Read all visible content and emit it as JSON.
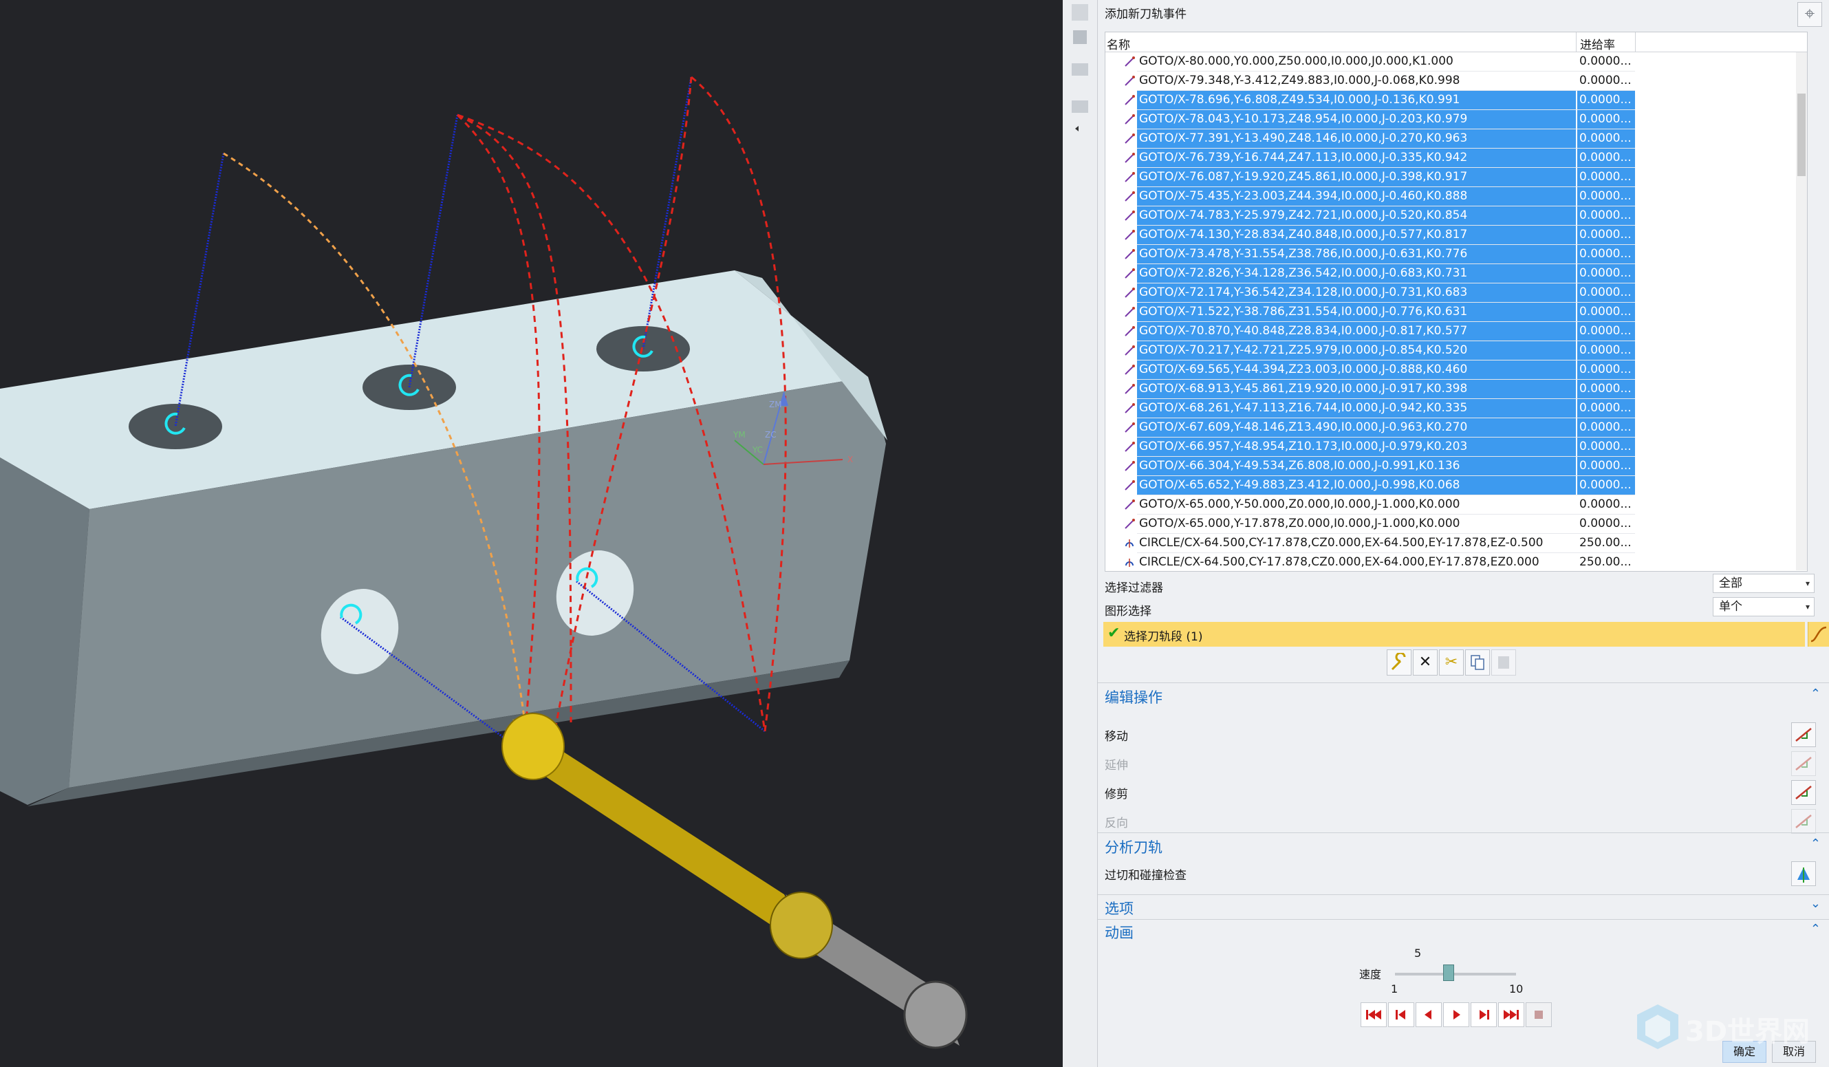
{
  "panel": {
    "title": "添加新刀轨事件",
    "list": {
      "col_name": "名称",
      "col_feed": "进给率",
      "rows": [
        {
          "name": "GOTO/X-80.000,Y0.000,Z50.000,I0.000,J0.000,K1.000",
          "feed": "0.0000...",
          "selected": false,
          "kind": "goto"
        },
        {
          "name": "GOTO/X-79.348,Y-3.412,Z49.883,I0.000,J-0.068,K0.998",
          "feed": "0.0000...",
          "selected": false,
          "kind": "goto"
        },
        {
          "name": "GOTO/X-78.696,Y-6.808,Z49.534,I0.000,J-0.136,K0.991",
          "feed": "0.0000...",
          "selected": true,
          "kind": "goto"
        },
        {
          "name": "GOTO/X-78.043,Y-10.173,Z48.954,I0.000,J-0.203,K0.979",
          "feed": "0.0000...",
          "selected": true,
          "kind": "goto"
        },
        {
          "name": "GOTO/X-77.391,Y-13.490,Z48.146,I0.000,J-0.270,K0.963",
          "feed": "0.0000...",
          "selected": true,
          "kind": "goto"
        },
        {
          "name": "GOTO/X-76.739,Y-16.744,Z47.113,I0.000,J-0.335,K0.942",
          "feed": "0.0000...",
          "selected": true,
          "kind": "goto"
        },
        {
          "name": "GOTO/X-76.087,Y-19.920,Z45.861,I0.000,J-0.398,K0.917",
          "feed": "0.0000...",
          "selected": true,
          "kind": "goto"
        },
        {
          "name": "GOTO/X-75.435,Y-23.003,Z44.394,I0.000,J-0.460,K0.888",
          "feed": "0.0000...",
          "selected": true,
          "kind": "goto"
        },
        {
          "name": "GOTO/X-74.783,Y-25.979,Z42.721,I0.000,J-0.520,K0.854",
          "feed": "0.0000...",
          "selected": true,
          "kind": "goto"
        },
        {
          "name": "GOTO/X-74.130,Y-28.834,Z40.848,I0.000,J-0.577,K0.817",
          "feed": "0.0000...",
          "selected": true,
          "kind": "goto"
        },
        {
          "name": "GOTO/X-73.478,Y-31.554,Z38.786,I0.000,J-0.631,K0.776",
          "feed": "0.0000...",
          "selected": true,
          "kind": "goto"
        },
        {
          "name": "GOTO/X-72.826,Y-34.128,Z36.542,I0.000,J-0.683,K0.731",
          "feed": "0.0000...",
          "selected": true,
          "kind": "goto"
        },
        {
          "name": "GOTO/X-72.174,Y-36.542,Z34.128,I0.000,J-0.731,K0.683",
          "feed": "0.0000...",
          "selected": true,
          "kind": "goto"
        },
        {
          "name": "GOTO/X-71.522,Y-38.786,Z31.554,I0.000,J-0.776,K0.631",
          "feed": "0.0000...",
          "selected": true,
          "kind": "goto"
        },
        {
          "name": "GOTO/X-70.870,Y-40.848,Z28.834,I0.000,J-0.817,K0.577",
          "feed": "0.0000...",
          "selected": true,
          "kind": "goto"
        },
        {
          "name": "GOTO/X-70.217,Y-42.721,Z25.979,I0.000,J-0.854,K0.520",
          "feed": "0.0000...",
          "selected": true,
          "kind": "goto"
        },
        {
          "name": "GOTO/X-69.565,Y-44.394,Z23.003,I0.000,J-0.888,K0.460",
          "feed": "0.0000...",
          "selected": true,
          "kind": "goto"
        },
        {
          "name": "GOTO/X-68.913,Y-45.861,Z19.920,I0.000,J-0.917,K0.398",
          "feed": "0.0000...",
          "selected": true,
          "kind": "goto"
        },
        {
          "name": "GOTO/X-68.261,Y-47.113,Z16.744,I0.000,J-0.942,K0.335",
          "feed": "0.0000...",
          "selected": true,
          "kind": "goto"
        },
        {
          "name": "GOTO/X-67.609,Y-48.146,Z13.490,I0.000,J-0.963,K0.270",
          "feed": "0.0000...",
          "selected": true,
          "kind": "goto"
        },
        {
          "name": "GOTO/X-66.957,Y-48.954,Z10.173,I0.000,J-0.979,K0.203",
          "feed": "0.0000...",
          "selected": true,
          "kind": "goto"
        },
        {
          "name": "GOTO/X-66.304,Y-49.534,Z6.808,I0.000,J-0.991,K0.136",
          "feed": "0.0000...",
          "selected": true,
          "kind": "goto"
        },
        {
          "name": "GOTO/X-65.652,Y-49.883,Z3.412,I0.000,J-0.998,K0.068",
          "feed": "0.0000...",
          "selected": true,
          "kind": "goto"
        },
        {
          "name": "GOTO/X-65.000,Y-50.000,Z0.000,I0.000,J-1.000,K0.000",
          "feed": "0.0000...",
          "selected": false,
          "kind": "goto"
        },
        {
          "name": "GOTO/X-65.000,Y-17.878,Z0.000,I0.000,J-1.000,K0.000",
          "feed": "0.0000...",
          "selected": false,
          "kind": "goto"
        },
        {
          "name": "CIRCLE/CX-64.500,CY-17.878,CZ0.000,EX-64.500,EY-17.878,EZ-0.500",
          "feed": "250.00...",
          "selected": false,
          "kind": "circle"
        },
        {
          "name": "CIRCLE/CX-64.500,CY-17.878,CZ0.000,EX-64.000,EY-17.878,EZ0.000",
          "feed": "250.00...",
          "selected": false,
          "kind": "circle"
        }
      ]
    },
    "filter_label": "选择过滤器",
    "filter_value": "全部",
    "graphic_label": "图形选择",
    "graphic_value": "单个",
    "select_segment": "选择刀轨段 (1)",
    "edit_section": "编辑操作",
    "ops": [
      {
        "label": "移动",
        "enabled": true
      },
      {
        "label": "延伸",
        "enabled": false
      },
      {
        "label": "修剪",
        "enabled": true
      },
      {
        "label": "反向",
        "enabled": false
      }
    ],
    "analyze_section": "分析刀轨",
    "gouge_check": "过切和碰撞检查",
    "options_section": "选项",
    "animation_section": "动画",
    "speed_label": "速度",
    "speed_value": "5",
    "speed_min": "1",
    "speed_max": "10",
    "speed_fraction": 0.444,
    "ok_button": "确定",
    "cancel_button": "取消"
  },
  "viewport": {
    "axis_labels": {
      "zm": "ZM",
      "zc": "ZC",
      "ym": "YM",
      "yc": "YC",
      "x": "X"
    }
  },
  "watermark": "3D世界网",
  "colors": {
    "selection": "#3d9aef",
    "accent": "#1b6ec2",
    "highlight": "#fbd96e",
    "tool": "#d4b10a"
  }
}
